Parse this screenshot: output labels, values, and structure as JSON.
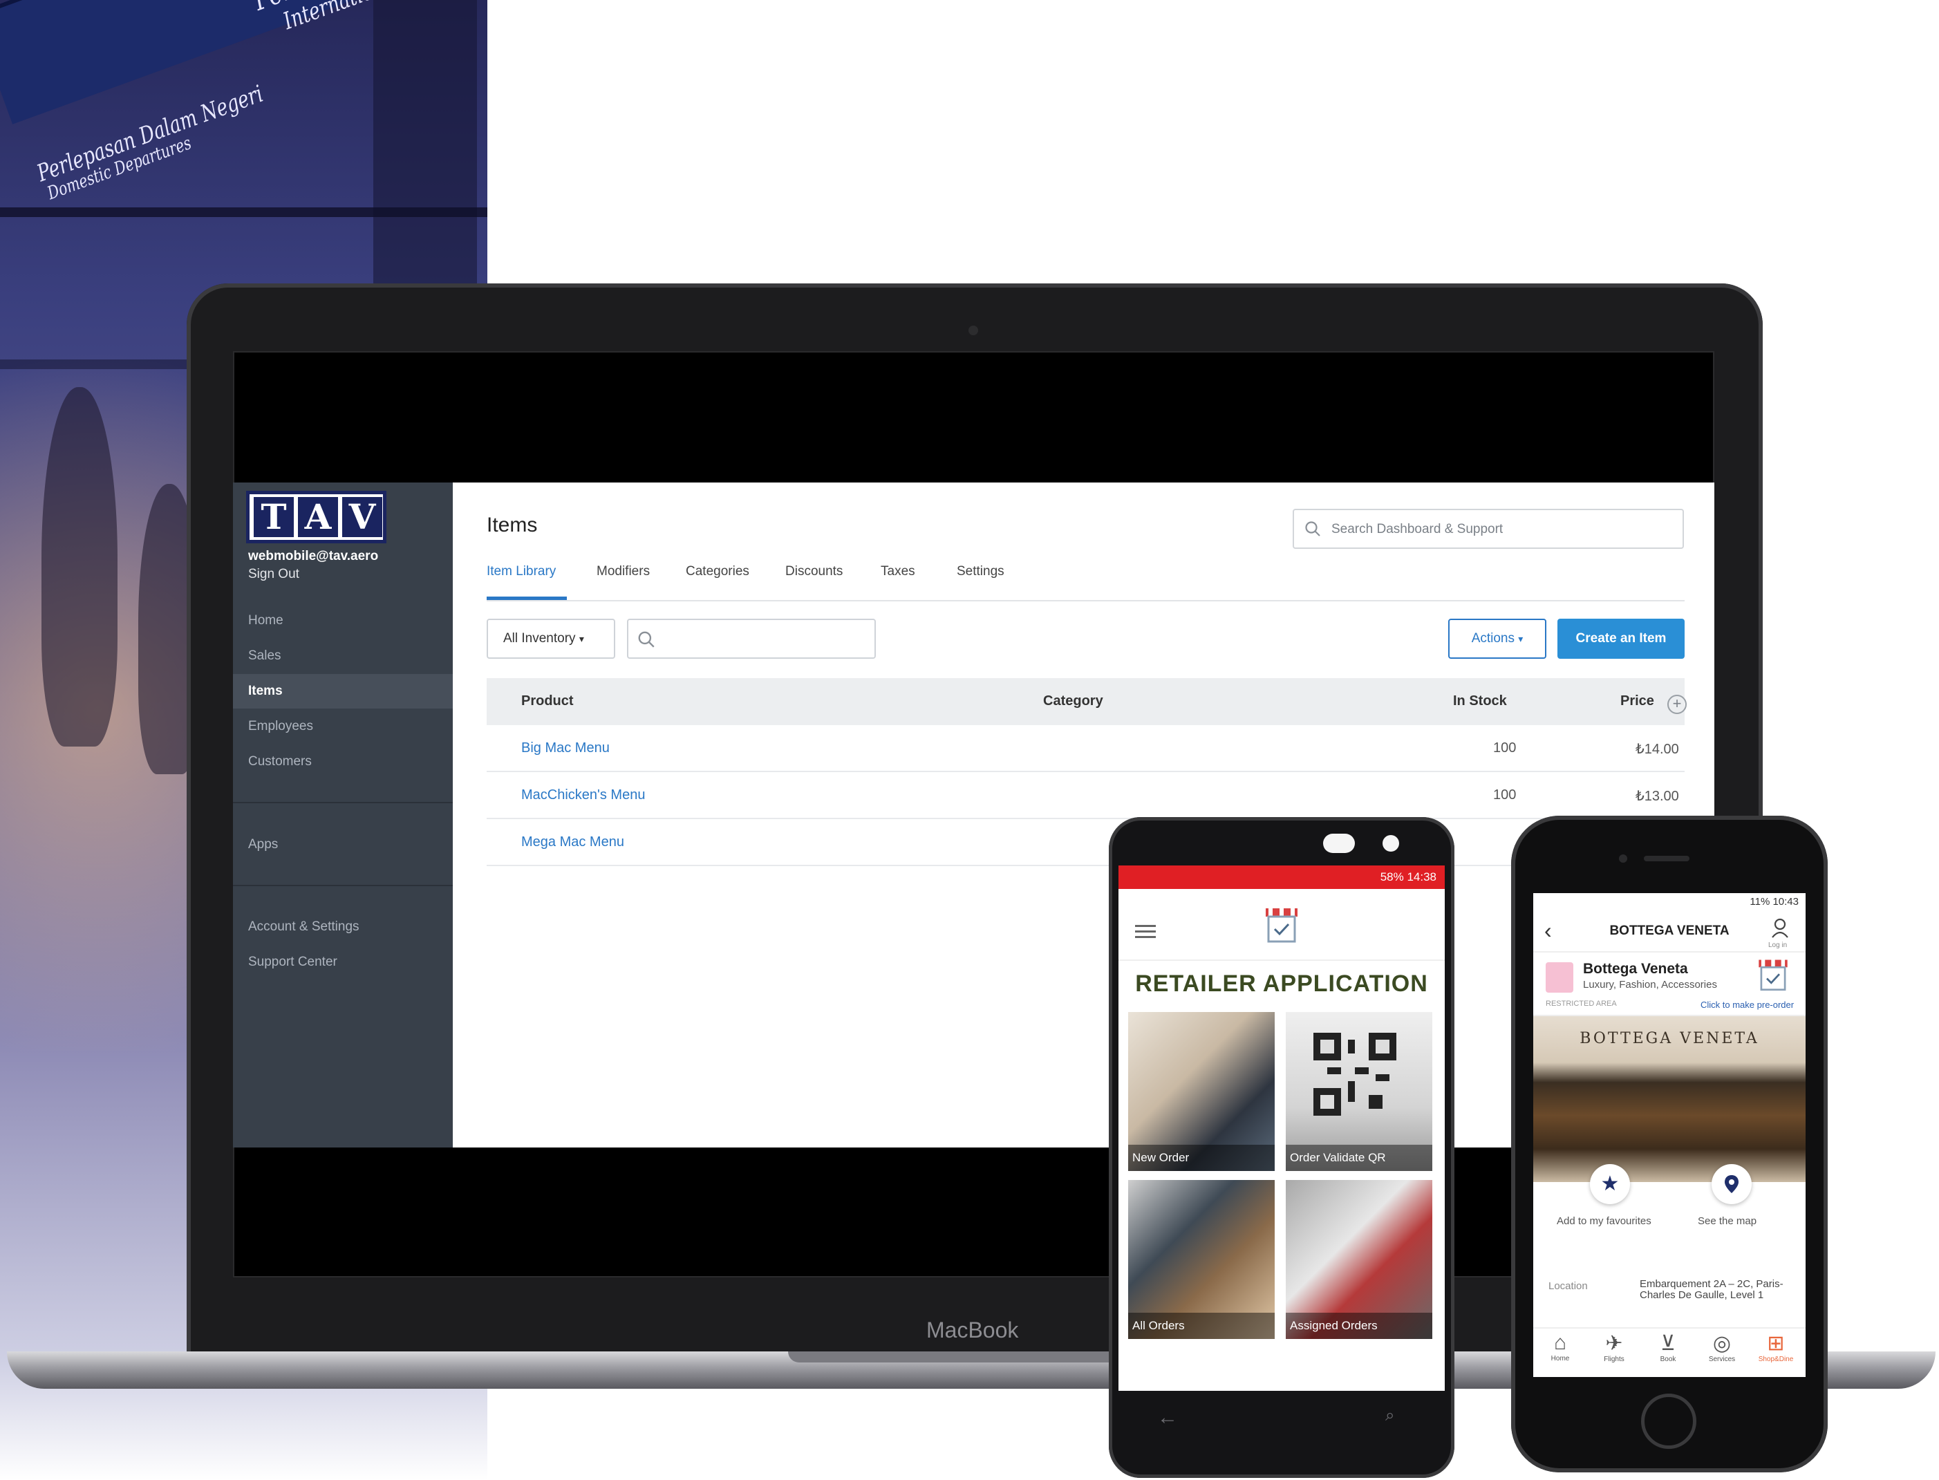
{
  "backdrop": {
    "sign_lines": [
      "Perlepasan Dalam Negeri",
      "Domestic Departures",
      "Perlepasan Antarabangsa",
      "International Departures"
    ]
  },
  "laptop": {
    "brand": "MacBook"
  },
  "sidebar": {
    "logo_letters": [
      "T",
      "A",
      "V"
    ],
    "email": "webmobile@tav.aero",
    "sign_out": "Sign Out",
    "nav": [
      "Home",
      "Sales",
      "Items",
      "Employees",
      "Customers"
    ],
    "active": "Items",
    "apps": "Apps",
    "account": "Account & Settings",
    "support": "Support Center"
  },
  "main": {
    "title": "Items",
    "search_placeholder": "Search Dashboard & Support",
    "tabs": [
      "Item Library",
      "Modifiers",
      "Categories",
      "Discounts",
      "Taxes",
      "Settings"
    ],
    "active_tab": "Item Library",
    "filter_label": "All Inventory",
    "actions_label": "Actions",
    "create_label": "Create an Item",
    "table": {
      "columns": [
        "Product",
        "Category",
        "In Stock",
        "Price"
      ],
      "rows": [
        {
          "product": "Big Mac Menu",
          "category": "",
          "in_stock": "100",
          "price": "₺14.00"
        },
        {
          "product": "MacChicken's Menu",
          "category": "",
          "in_stock": "100",
          "price": "₺13.00"
        },
        {
          "product": "Mega Mac Menu",
          "category": "",
          "in_stock": "",
          "price": ""
        }
      ]
    }
  },
  "phone_android": {
    "status_text": "58% 14:38",
    "title": "RETAILER APPLICATION",
    "tiles": [
      "New Order",
      "Order Validate QR",
      "All Orders",
      "Assigned Orders"
    ]
  },
  "phone_iphone": {
    "status_text": "11% 10:43",
    "header_title": "BOTTEGA VENETA",
    "user_label": "Log in",
    "store_name": "Bottega Veneta",
    "store_sub": "Luxury, Fashion, Accessories",
    "restricted": "RESTRICTED AREA",
    "preorder": "Click to make pre-order",
    "photo_brand": "BOTTEGA VENETA",
    "fav_label": "Add to my favourites",
    "map_label": "See the map",
    "location_label": "Location",
    "location_value": "Embarquement 2A – 2C, Paris-Charles De Gaulle, Level 1",
    "tabs": [
      "Home",
      "Flights",
      "Book",
      "Services",
      "Shop&Dine"
    ]
  },
  "colors": {
    "accent": "#2a78c6",
    "sidebar": "#38404a",
    "android_status": "#e01f24",
    "retailer_title": "#3b4a22"
  }
}
